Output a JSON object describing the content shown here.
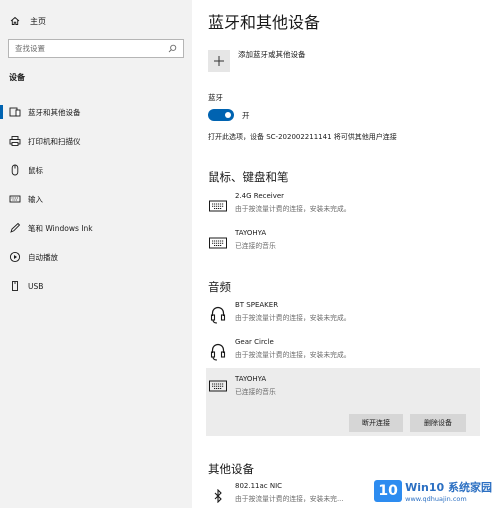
{
  "sidebar": {
    "home_label": "主页",
    "search_placeholder": "查找设置",
    "section_title": "设备",
    "items": [
      {
        "label": "蓝牙和其他设备",
        "icon": "bluetooth-devices-icon",
        "selected": true
      },
      {
        "label": "打印机和扫描仪",
        "icon": "printer-icon",
        "selected": false
      },
      {
        "label": "鼠标",
        "icon": "mouse-icon",
        "selected": false
      },
      {
        "label": "输入",
        "icon": "keyboard-icon",
        "selected": false
      },
      {
        "label": "笔和 Windows Ink",
        "icon": "pen-icon",
        "selected": false
      },
      {
        "label": "自动播放",
        "icon": "autoplay-icon",
        "selected": false
      },
      {
        "label": "USB",
        "icon": "usb-icon",
        "selected": false
      }
    ]
  },
  "main": {
    "title": "蓝牙和其他设备",
    "add_device_label": "添加蓝牙或其他设备",
    "bluetooth_label": "蓝牙",
    "bluetooth_state": "开",
    "bluetooth_on": true,
    "discoverable_text": "打开此选项，设备 SC-202002211141 将可供其他用户连接",
    "groups": {
      "input": {
        "title": "鼠标、键盘和笔",
        "devices": [
          {
            "name": "2.4G Receiver",
            "status": "由于按流量计费的连接，安装未完成。",
            "icon": "keyboard-icon"
          },
          {
            "name": "TAYOHYA",
            "status": "已连接的音乐",
            "icon": "keyboard-icon"
          }
        ]
      },
      "audio": {
        "title": "音频",
        "devices": [
          {
            "name": "BT SPEAKER",
            "status": "由于按流量计费的连接，安装未完成。",
            "icon": "headset-icon"
          },
          {
            "name": "Gear Circle",
            "status": "由于按流量计费的连接，安装未完成。",
            "icon": "headset-icon"
          },
          {
            "name": "TAYOHYA",
            "status": "已连接的音乐",
            "icon": "keyboard-icon",
            "selected": true
          }
        ],
        "disconnect_label": "断开连接",
        "remove_label": "删除设备"
      },
      "other": {
        "title": "其他设备",
        "devices": [
          {
            "name": "802.11ac NIC",
            "status": "由于按流量计费的连接，安装未完...",
            "icon": "bluetooth-icon"
          }
        ]
      }
    }
  },
  "watermark": {
    "badge": "10",
    "title": "Win10 系统家园",
    "url": "www.qdhuajin.com"
  },
  "colors": {
    "accent": "#0063b1",
    "sidebar_bg": "#f2f2f2",
    "selected_device_bg": "#ececec",
    "button_bg": "#d6d6d6"
  }
}
